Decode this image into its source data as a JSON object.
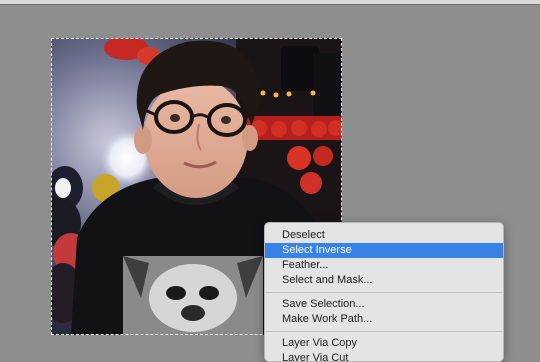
{
  "canvas": {
    "image_description_icon": "photo-layer-icon",
    "selection_mode": "marching-ants"
  },
  "context_menu": {
    "groups": [
      {
        "items": [
          {
            "label": "Deselect",
            "highlighted": false
          },
          {
            "label": "Select Inverse",
            "highlighted": true
          },
          {
            "label": "Feather...",
            "highlighted": false
          },
          {
            "label": "Select and Mask...",
            "highlighted": false
          }
        ]
      },
      {
        "items": [
          {
            "label": "Save Selection...",
            "highlighted": false
          },
          {
            "label": "Make Work Path...",
            "highlighted": false
          }
        ]
      },
      {
        "items": [
          {
            "label": "Layer Via Copy",
            "highlighted": false
          },
          {
            "label": "Layer Via Cut",
            "highlighted": false
          }
        ]
      }
    ]
  },
  "colors": {
    "workspace": "#8e8e8e",
    "menu_background": "#e4e4e4",
    "menu_highlight": "#3a83e6"
  }
}
